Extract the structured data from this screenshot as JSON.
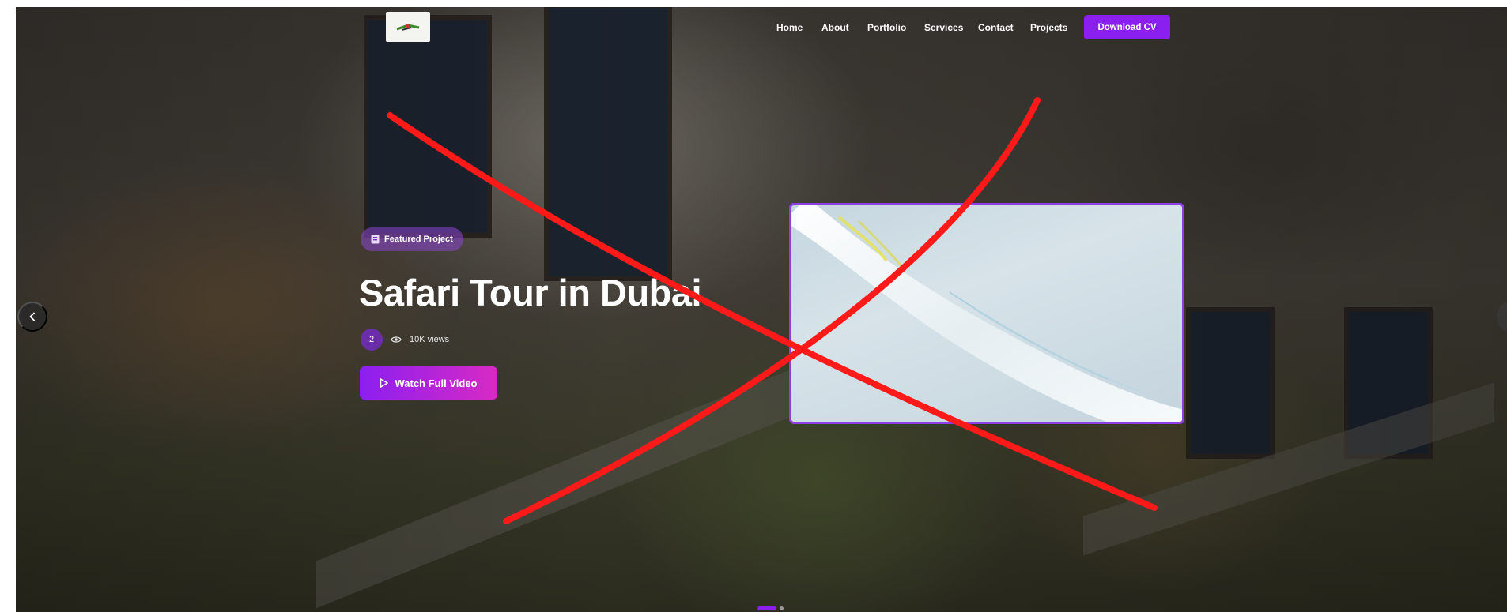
{
  "nav": {
    "links": [
      "Home",
      "About",
      "Portfolio",
      "Services",
      "Contact",
      "Projects"
    ],
    "cta": "Download CV"
  },
  "hero": {
    "badge": "Featured Project",
    "title": "Safari Tour in Dubai",
    "count": "2",
    "views": "10K views",
    "watch_label": "Watch Full Video"
  },
  "slider": {
    "dots": 2,
    "active_index": 0
  },
  "colors": {
    "accent": "#8b1ff0",
    "accent_pink": "#d82ac4",
    "overlay_mark": "#ff0000"
  },
  "icons": {
    "badge": "document-icon",
    "views": "eye-icon",
    "play": "play-icon",
    "prev": "chevron-left-icon",
    "logo": "logo-icon"
  }
}
